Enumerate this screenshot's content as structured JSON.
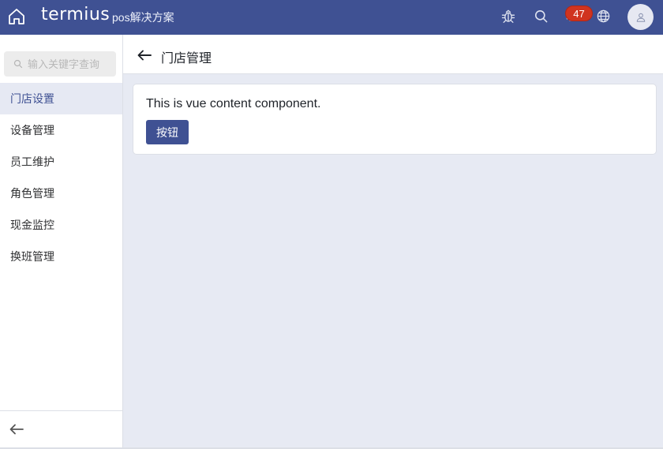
{
  "topbar": {
    "logo": "termius",
    "subtitle": "pos解决方案",
    "notification_count": "47",
    "icons": [
      "home-icon",
      "bug-icon",
      "search-icon",
      "bell-icon",
      "globe-icon",
      "user-icon"
    ]
  },
  "sidebar": {
    "search_placeholder": "输入关键字查询",
    "items": [
      {
        "label": "门店设置",
        "active": true
      },
      {
        "label": "设备管理",
        "active": false
      },
      {
        "label": "员工维护",
        "active": false
      },
      {
        "label": "角色管理",
        "active": false
      },
      {
        "label": "现金监控",
        "active": false
      },
      {
        "label": "换班管理",
        "active": false
      }
    ]
  },
  "page": {
    "title": "门店管理",
    "content_text": "This is vue content component.",
    "button_label": "按钮"
  },
  "colors": {
    "primary": "#3f5193",
    "background": "#e7eaf3",
    "badge": "#d0341f",
    "active_item_bg": "#e6e9f3"
  }
}
